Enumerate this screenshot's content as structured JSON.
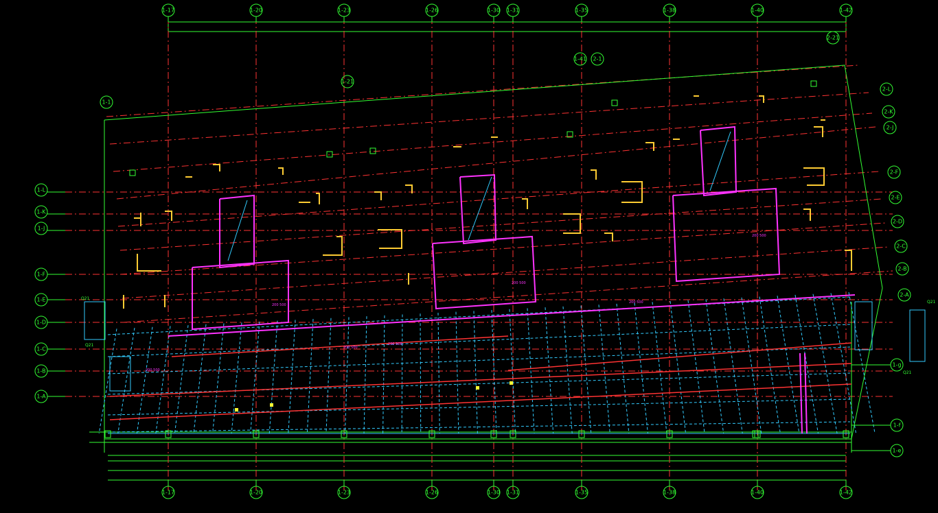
{
  "colors": {
    "background": "#000000",
    "grid_axis": "#33ff33",
    "axis_line": "#ff3333",
    "beam": "#ff3333",
    "beam_dashed": "#33ccff",
    "column": "#ffcc33",
    "wall": "#ff33ff",
    "dimension": "#33ff33",
    "annotation": "#ff33ff"
  },
  "top_axes": [
    "1-17",
    "1-20",
    "1-23",
    "1-26",
    "1-30",
    "1-31",
    "1-35",
    "1-38",
    "1-40",
    "1-42"
  ],
  "bottom_axes": [
    "1-17",
    "1-20",
    "1-23",
    "1-26",
    "1-30",
    "1-31",
    "1-35",
    "1-38",
    "1-40",
    "1-42"
  ],
  "left_axes": [
    "1-L",
    "1-K",
    "1-J",
    "1-F",
    "1-E",
    "1-D",
    "1-C",
    "1-B",
    "1-A"
  ],
  "right_axes_upper": [
    "2-L",
    "2-K",
    "2-J",
    "2-F",
    "2-E",
    "2-D",
    "2-C",
    "2-B",
    "2-A"
  ],
  "right_axes_lower": [
    "1-g",
    "1-f",
    "1-e"
  ],
  "oblique_top_axes": [
    "1-1",
    "1-21",
    "1-41",
    "2-1",
    "2-21"
  ],
  "side_labels": [
    "Q21",
    "Q21",
    "Q21",
    "Q21"
  ],
  "annotations": [
    "200 500",
    "200 500",
    "200 500",
    "200 500",
    "200 500",
    "200 500",
    "200 500"
  ]
}
